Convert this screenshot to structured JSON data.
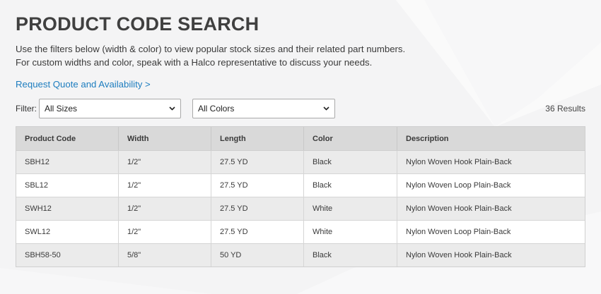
{
  "header": {
    "title": "PRODUCT CODE SEARCH",
    "intro_line_1": "Use the filters below (width & color) to view popular stock sizes and their related part numbers.",
    "intro_line_2": "For custom widths and color, speak with a Halco representative to discuss your needs.",
    "cta_label": "Request Quote and Availability >"
  },
  "filters": {
    "label": "Filter:",
    "size_selected": "All Sizes",
    "color_selected": "All Colors",
    "results_text": "36 Results"
  },
  "table": {
    "columns": [
      "Product Code",
      "Width",
      "Length",
      "Color",
      "Description"
    ],
    "rows": [
      [
        "SBH12",
        "1/2\"",
        "27.5 YD",
        "Black",
        "Nylon Woven Hook Plain-Back"
      ],
      [
        "SBL12",
        "1/2\"",
        "27.5 YD",
        "Black",
        "Nylon Woven Loop Plain-Back"
      ],
      [
        "SWH12",
        "1/2\"",
        "27.5 YD",
        "White",
        "Nylon Woven Hook Plain-Back"
      ],
      [
        "SWL12",
        "1/2\"",
        "27.5 YD",
        "White",
        "Nylon Woven Loop Plain-Back"
      ],
      [
        "SBH58-50",
        "5/8\"",
        "50 YD",
        "Black",
        "Nylon Woven Hook Plain-Back"
      ]
    ]
  },
  "colors": {
    "link": "#1d7dbf",
    "header_row": "#d9d9d9",
    "zebra_row": "#ebebeb",
    "page_bg": "#f4f4f5"
  }
}
